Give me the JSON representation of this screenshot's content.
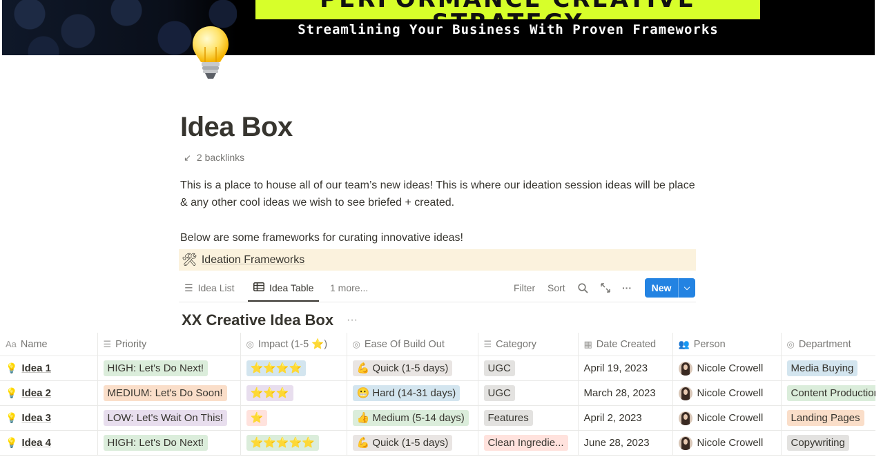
{
  "banner": {
    "title": "PERFORMANCE CREATIVE STRATEGY",
    "subtitle": "Streamlining Your Business With Proven Frameworks"
  },
  "page": {
    "icon": "lightbulb-icon",
    "title": "Idea Box",
    "backlinks": "2 backlinks",
    "description": "This is a place to house all of our team’s new ideas! This is where our ideation session ideas will be place & any other cool ideas we wish to see briefed + created.",
    "frameworks_intro": "Below are some frameworks for curating innovative ideas!",
    "callout": {
      "icon": "hammer-wrench-icon",
      "text": "Ideation Frameworks"
    }
  },
  "views": {
    "tabs": [
      {
        "label": "Idea List",
        "icon": "list-icon",
        "active": false
      },
      {
        "label": "Idea Table",
        "icon": "table-icon",
        "active": true
      }
    ],
    "more": "1 more...",
    "filter": "Filter",
    "sort": "Sort",
    "new": "New"
  },
  "database": {
    "title": "XX Creative Idea Box",
    "columns": [
      {
        "label": "Name",
        "icon": "Aa"
      },
      {
        "label": "Priority",
        "icon": "☰"
      },
      {
        "label": "Impact (1-5 ⭐)",
        "icon": "◎"
      },
      {
        "label": "Ease Of Build Out",
        "icon": "◎"
      },
      {
        "label": "Category",
        "icon": "☰"
      },
      {
        "label": "Date Created",
        "icon": "▦"
      },
      {
        "label": "Person",
        "icon": "👥"
      },
      {
        "label": "Department",
        "icon": "◎"
      }
    ],
    "rows": [
      {
        "name": "Idea 1",
        "priority": "HIGH: Let's Do Next!",
        "priority_bg": "#dbeddb",
        "impact": "⭐⭐⭐⭐",
        "impact_bg": "#d3e5ef",
        "ease": "💪 Quick (1-5 days)",
        "ease_bg": "#e9e5e3",
        "category": "UGC",
        "category_bg": "#e3e2e0",
        "date": "April 19, 2023",
        "person": "Nicole Crowell",
        "department": "Media Buying",
        "department_bg": "#d3e5ef"
      },
      {
        "name": "Idea 2",
        "priority": "MEDIUM: Let's Do Soon!",
        "priority_bg": "#fadec9",
        "impact": "⭐⭐⭐",
        "impact_bg": "#e8deee",
        "ease": "😬 Hard (14-31 days)",
        "ease_bg": "#d3e5ef",
        "category": "UGC",
        "category_bg": "#e3e2e0",
        "date": "March 28, 2023",
        "person": "Nicole Crowell",
        "department": "Content Production",
        "department_bg": "#dbeddb"
      },
      {
        "name": "Idea 3",
        "priority": "LOW: Let's Wait On This!",
        "priority_bg": "#e8deee",
        "impact": "⭐",
        "impact_bg": "#ffe2dd",
        "ease": "👍 Medium (5-14 days)",
        "ease_bg": "#dbeddb",
        "category": "Features",
        "category_bg": "#e3e2e0",
        "date": "April 2, 2023",
        "person": "Nicole Crowell",
        "department": "Landing Pages",
        "department_bg": "#fadec9"
      },
      {
        "name": "Idea 4",
        "priority": "HIGH: Let's Do Next!",
        "priority_bg": "#dbeddb",
        "impact": "⭐⭐⭐⭐⭐",
        "impact_bg": "#dbeddb",
        "ease": "💪 Quick (1-5 days)",
        "ease_bg": "#e9e5e3",
        "category": "Clean Ingredie...",
        "category_bg": "#ffe2dd",
        "date": "June 28, 2023",
        "person": "Nicole Crowell",
        "department": "Copywriting",
        "department_bg": "#e3e2e0"
      }
    ]
  }
}
